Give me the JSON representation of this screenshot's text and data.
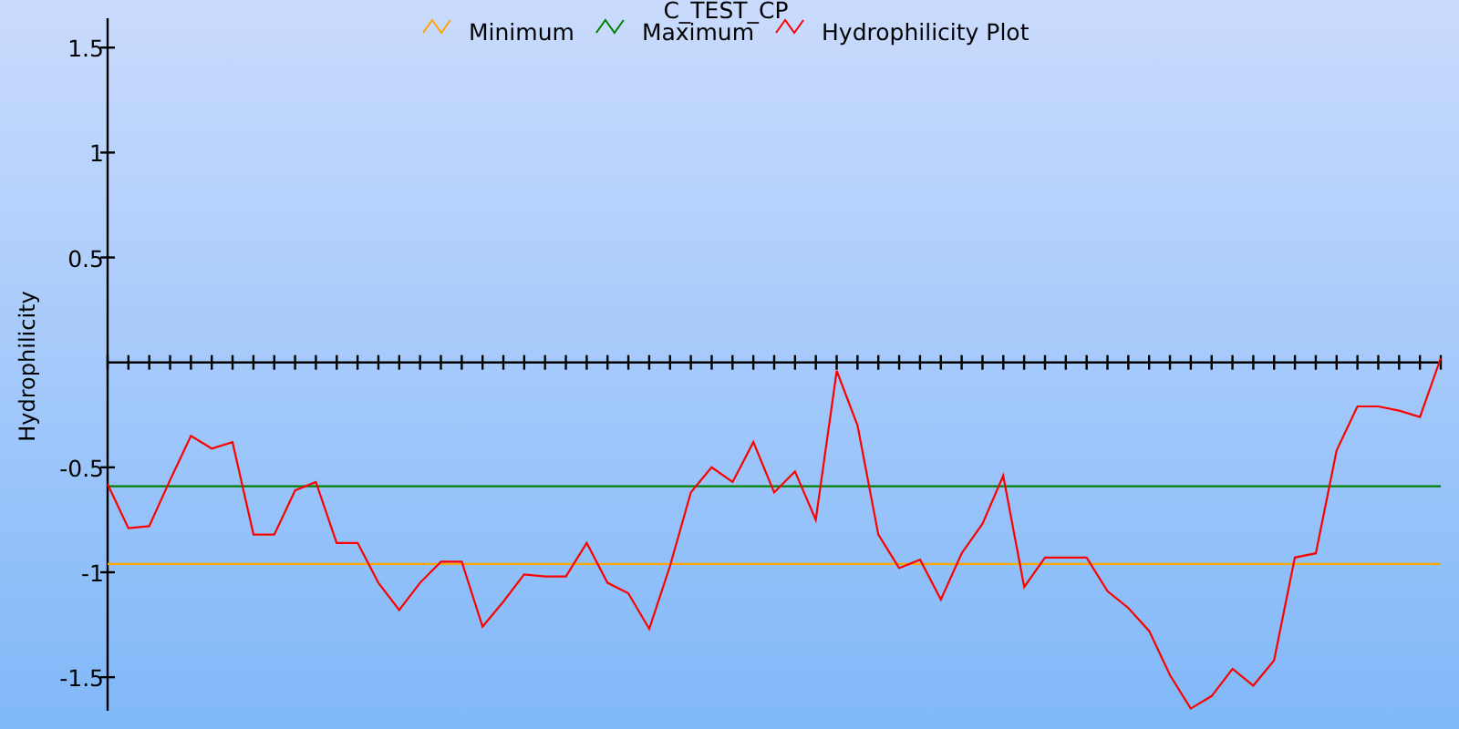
{
  "chart_data": {
    "type": "line",
    "title": "C_TEST_CP",
    "legend": true,
    "ylabel": "Hydrophilicity",
    "ylim": [
      -1.66,
      1.64
    ],
    "yticks": [
      -1.5,
      -1,
      -0.5,
      0.5,
      1,
      1.5
    ],
    "series": [
      {
        "name": "Minimum",
        "color": "#ffa500",
        "values": [
          -0.96,
          -0.96,
          -0.96,
          -0.96,
          -0.96,
          -0.96,
          -0.96,
          -0.96,
          -0.96,
          -0.96,
          -0.96,
          -0.96,
          -0.96,
          -0.96,
          -0.96,
          -0.96,
          -0.96,
          -0.96,
          -0.96,
          -0.96,
          -0.96,
          -0.96,
          -0.96,
          -0.96,
          -0.96,
          -0.96,
          -0.96,
          -0.96,
          -0.96,
          -0.96,
          -0.96,
          -0.96,
          -0.96,
          -0.96,
          -0.96,
          -0.96,
          -0.96,
          -0.96,
          -0.96,
          -0.96,
          -0.96,
          -0.96,
          -0.96,
          -0.96,
          -0.96,
          -0.96,
          -0.96,
          -0.96,
          -0.96,
          -0.96,
          -0.96,
          -0.96,
          -0.96,
          -0.96,
          -0.96,
          -0.96,
          -0.96,
          -0.96,
          -0.96,
          -0.96,
          -0.96,
          -0.96,
          -0.96,
          -0.96,
          -0.96
        ]
      },
      {
        "name": "Maximum",
        "color": "#008000",
        "values": [
          -0.59,
          -0.59,
          -0.59,
          -0.59,
          -0.59,
          -0.59,
          -0.59,
          -0.59,
          -0.59,
          -0.59,
          -0.59,
          -0.59,
          -0.59,
          -0.59,
          -0.59,
          -0.59,
          -0.59,
          -0.59,
          -0.59,
          -0.59,
          -0.59,
          -0.59,
          -0.59,
          -0.59,
          -0.59,
          -0.59,
          -0.59,
          -0.59,
          -0.59,
          -0.59,
          -0.59,
          -0.59,
          -0.59,
          -0.59,
          -0.59,
          -0.59,
          -0.59,
          -0.59,
          -0.59,
          -0.59,
          -0.59,
          -0.59,
          -0.59,
          -0.59,
          -0.59,
          -0.59,
          -0.59,
          -0.59,
          -0.59,
          -0.59,
          -0.59,
          -0.59,
          -0.59,
          -0.59,
          -0.59,
          -0.59,
          -0.59,
          -0.59,
          -0.59,
          -0.59,
          -0.59,
          -0.59,
          -0.59,
          -0.59,
          -0.59
        ]
      },
      {
        "name": "Hydrophilicity Plot",
        "color": "#ff0000",
        "values": [
          -0.58,
          -0.79,
          -0.78,
          -0.56,
          -0.35,
          -0.41,
          -0.38,
          -0.82,
          -0.82,
          -0.61,
          -0.57,
          -0.86,
          -0.86,
          -1.05,
          -1.18,
          -1.05,
          -0.95,
          -0.95,
          -1.26,
          -1.14,
          -1.01,
          -1.02,
          -1.02,
          -0.86,
          -1.05,
          -1.1,
          -1.27,
          -0.97,
          -0.62,
          -0.5,
          -0.57,
          -0.38,
          -0.62,
          -0.52,
          -0.75,
          -0.04,
          -0.3,
          -0.82,
          -0.98,
          -0.94,
          -1.13,
          -0.91,
          -0.77,
          -0.54,
          -1.07,
          -0.93,
          -0.93,
          -0.93,
          -1.09,
          -1.17,
          -1.28,
          -1.49,
          -1.65,
          -1.59,
          -1.46,
          -1.54,
          -1.42,
          -0.93,
          -0.91,
          -0.42,
          -0.21,
          -0.21,
          -0.23,
          -0.26,
          0.02
        ]
      }
    ]
  }
}
